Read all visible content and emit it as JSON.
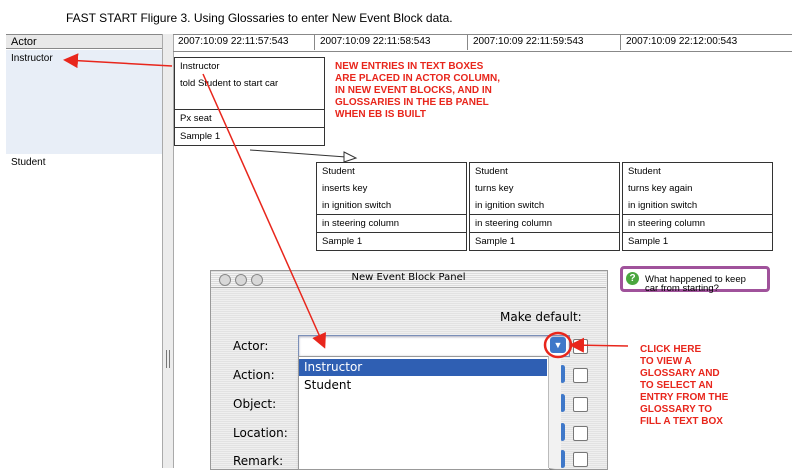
{
  "caption": "FAST START Fligure  3. Using Glossaries to enter New Event Block data.",
  "actor_column": {
    "header": "Actor",
    "items": [
      "Instructor",
      "Student"
    ]
  },
  "timestamps": [
    "2007:10:09 22:11:57:543",
    "2007:10:09 22:11:58:543",
    "2007:10:09 22:11:59:543",
    "2007:10:09 22:12:00:543"
  ],
  "instructor_block": {
    "actor": "Instructor",
    "action": "told Student to start car",
    "location": "Px seat",
    "source": "Sample 1"
  },
  "student_blocks": [
    {
      "actor": "Student",
      "action": "inserts key",
      "object": "in ignition switch",
      "location": "in steering column",
      "source": "Sample 1"
    },
    {
      "actor": "Student",
      "action": "turns key",
      "object": "in ignition switch",
      "location": "in steering column",
      "source": "Sample 1"
    },
    {
      "actor": "Student",
      "action": "turns key again",
      "object": "in ignition switch",
      "location": "in steering column",
      "source": "Sample 1"
    }
  ],
  "annotations": {
    "new_entries": [
      "NEW ENTRIES IN TEXT BOXES",
      "ARE PLACED IN ACTOR COLUMN,",
      "IN NEW EVENT BLOCKS, AND IN",
      "GLOSSARIES IN THE EB PANEL",
      "WHEN EB IS BUILT"
    ],
    "click_here": [
      "CLICK HERE",
      "TO VIEW A",
      "GLOSSARY AND",
      "TO SELECT AN",
      "ENTRY FROM THE",
      "GLOSSARY TO",
      "FILL A TEXT BOX"
    ]
  },
  "tooltip": {
    "line1": "What happened to  keep",
    "line2": "car from starting?"
  },
  "panel": {
    "title": "New Event Block Panel",
    "make_default": "Make default:",
    "labels": {
      "actor": "Actor:",
      "action": "Action:",
      "object": "Object:",
      "location": "Location:",
      "remark": "Remark:"
    },
    "glossary_options": [
      "Instructor",
      "Student"
    ],
    "selected_option": "Instructor"
  },
  "colors": {
    "annotation_red": "#e8261c",
    "selection_blue": "#2f5fb3",
    "tooltip_border": "#a0529b"
  }
}
